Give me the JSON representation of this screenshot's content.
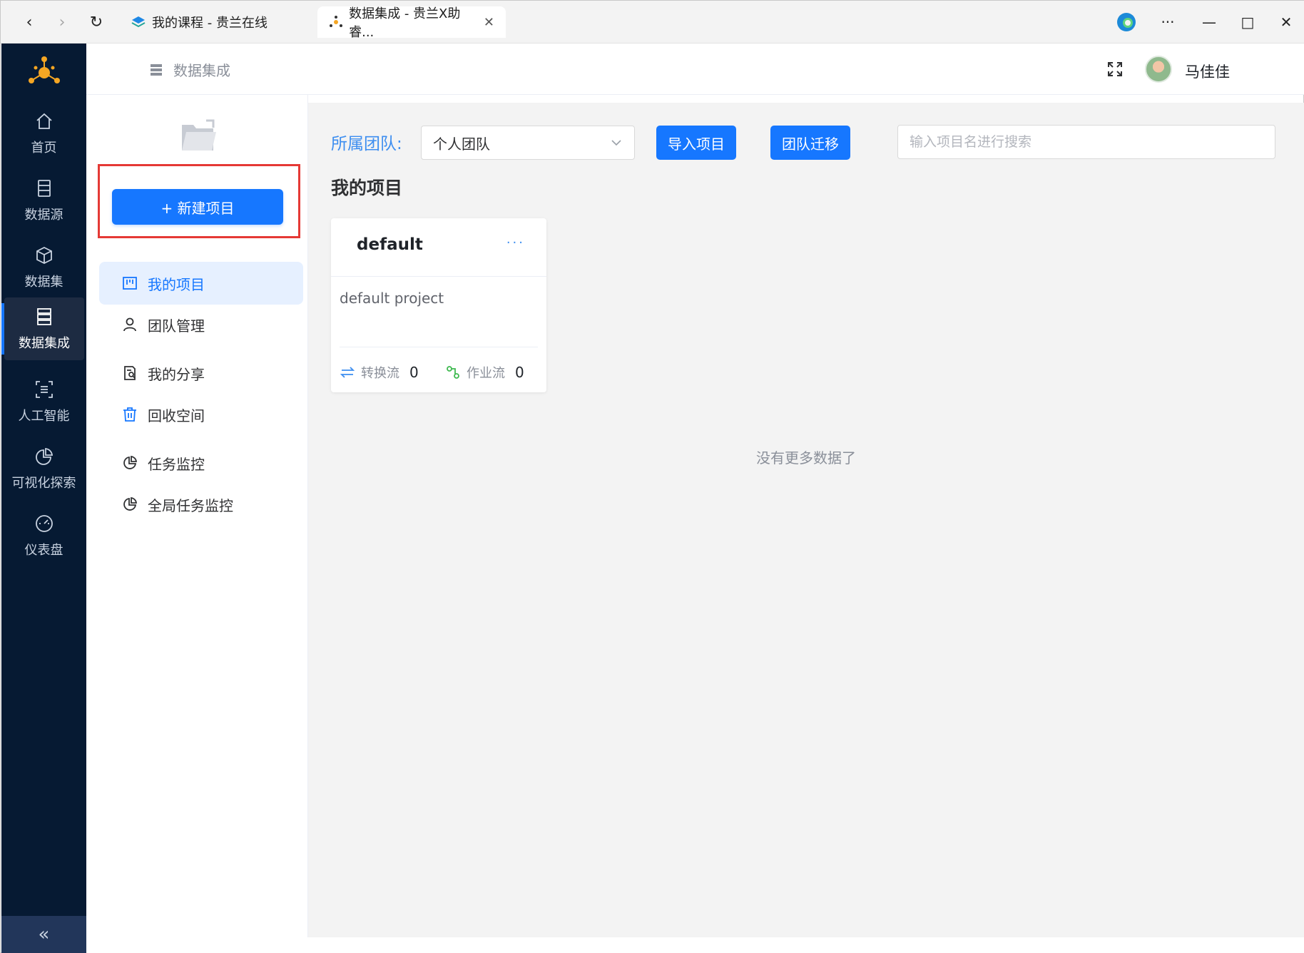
{
  "browser": {
    "tabs": [
      {
        "title": "我的课程 - 贵兰在线",
        "active": false
      },
      {
        "title": "数据集成 - 贵兰X助睿...",
        "active": true
      }
    ],
    "controls": {
      "back": "‹",
      "forward": "›",
      "reload": "↻",
      "more": "···",
      "minimize": "—",
      "maximize": "□",
      "close": "✕"
    }
  },
  "leftnav": {
    "items": [
      {
        "label": "首页",
        "icon": "home-icon"
      },
      {
        "label": "数据源",
        "icon": "database-icon"
      },
      {
        "label": "数据集",
        "icon": "cube-icon"
      },
      {
        "label": "数据集成",
        "icon": "server-icon",
        "active": true
      },
      {
        "label": "人工智能",
        "icon": "ai-icon"
      },
      {
        "label": "可视化探索",
        "icon": "pie-chart-icon"
      },
      {
        "label": "仪表盘",
        "icon": "dashboard-icon"
      }
    ],
    "collapse": "«"
  },
  "header": {
    "breadcrumb": "数据集成",
    "username": "马佳佳"
  },
  "sidebar": {
    "new_project": "+ 新建项目",
    "menu": [
      {
        "label": "我的项目",
        "icon": "project-icon",
        "active": true
      },
      {
        "label": "团队管理",
        "icon": "user-icon"
      },
      {
        "label": "我的分享",
        "icon": "share-icon"
      },
      {
        "label": "回收空间",
        "icon": "trash-icon"
      },
      {
        "label": "任务监控",
        "icon": "pie-icon"
      },
      {
        "label": "全局任务监控",
        "icon": "pie-icon"
      }
    ]
  },
  "main": {
    "team_label": "所属团队:",
    "team_value": "个人团队",
    "import_button": "导入项目",
    "migrate_button": "团队迁移",
    "search_placeholder": "输入项目名进行搜索",
    "section_title": "我的项目",
    "card": {
      "title": "default",
      "more": "···",
      "description": "default project",
      "transform_label": "转换流",
      "transform_count": "0",
      "job_label": "作业流",
      "job_count": "0"
    },
    "empty_text": "没有更多数据了"
  },
  "colors": {
    "primary": "#1677ff",
    "nav_bg": "#061a33",
    "highlight": "#e53935"
  }
}
